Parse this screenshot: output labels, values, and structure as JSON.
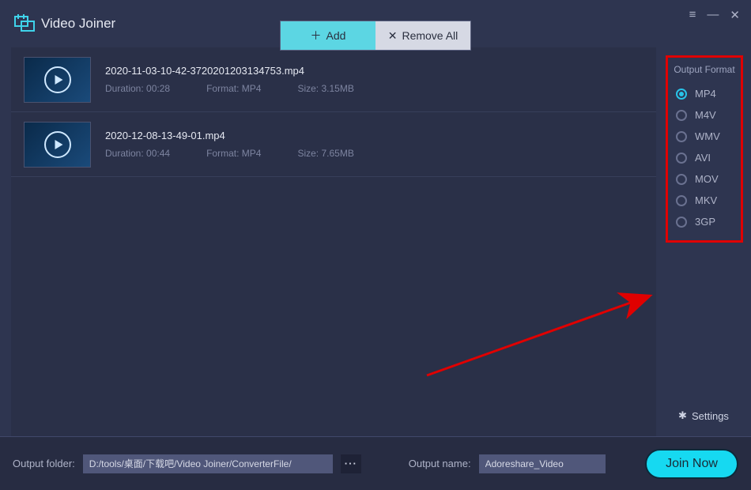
{
  "app": {
    "title": "Video Joiner"
  },
  "toolbar": {
    "add_label": "Add",
    "remove_label": "Remove All"
  },
  "win": {
    "menu": "≡",
    "minimize": "—",
    "close": "✕"
  },
  "files": [
    {
      "name": "2020-11-03-10-42-3720201203134753.mp4",
      "duration_label": "Duration:",
      "duration": "00:28",
      "format_label": "Format:",
      "format": "MP4",
      "size_label": "Size:",
      "size": "3.15MB"
    },
    {
      "name": "2020-12-08-13-49-01.mp4",
      "duration_label": "Duration:",
      "duration": "00:44",
      "format_label": "Format:",
      "format": "MP4",
      "size_label": "Size:",
      "size": "7.65MB"
    }
  ],
  "sidebar": {
    "title": "Output Format",
    "formats": [
      "MP4",
      "M4V",
      "WMV",
      "AVI",
      "MOV",
      "MKV",
      "3GP"
    ],
    "selected": "MP4",
    "settings_label": "Settings"
  },
  "footer": {
    "folder_label": "Output folder:",
    "folder_value": "D:/tools/桌面/下载吧/Video Joiner/ConverterFile/",
    "more": "···",
    "name_label": "Output name:",
    "name_value": "Adoreshare_Video",
    "join_label": "Join Now"
  }
}
